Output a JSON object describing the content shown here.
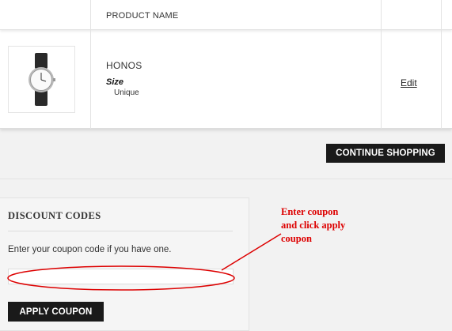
{
  "cart_table": {
    "header": {
      "product_name": "PRODUCT NAME"
    },
    "rows": [
      {
        "name": "HONOS",
        "option_label": "Size",
        "option_value": "Unique",
        "edit_label": "Edit",
        "image_icon": "watch-icon"
      }
    ]
  },
  "actions": {
    "continue_label": "CONTINUE SHOPPING"
  },
  "discount": {
    "title": "DISCOUNT CODES",
    "hint": "Enter your coupon code if you have one.",
    "coupon_value": "",
    "apply_label": "APPLY COUPON"
  },
  "annotation": {
    "lines": [
      "Enter coupon",
      "and click apply",
      "coupon"
    ],
    "color": "#d00000"
  },
  "colors": {
    "button_bg": "#1a1a1a",
    "page_bg": "#f2f2f2",
    "annotation": "#d00000"
  }
}
